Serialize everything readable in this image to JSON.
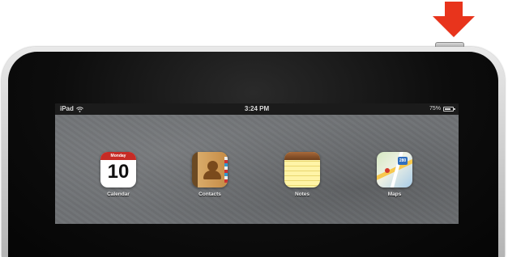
{
  "status_bar": {
    "device_name": "iPad",
    "time": "3:24 PM",
    "battery": "75%",
    "battery_level": 0.75,
    "wifi_icon": "wifi-icon",
    "battery_icon": "battery-icon"
  },
  "apps": [
    {
      "label": "Calendar",
      "icon": "calendar-icon",
      "month": "Monday",
      "day": "10"
    },
    {
      "label": "Contacts",
      "icon": "contacts-icon"
    },
    {
      "label": "Notes",
      "icon": "notes-icon"
    },
    {
      "label": "Maps",
      "icon": "maps-icon",
      "shield": "280"
    }
  ],
  "indicator": {
    "icon": "red-arrow-down-icon",
    "color": "#e8341c"
  },
  "colors": {
    "status_bar": "#1b1b1b",
    "wallpaper": "#6f7275",
    "arrow": "#e8341c"
  }
}
